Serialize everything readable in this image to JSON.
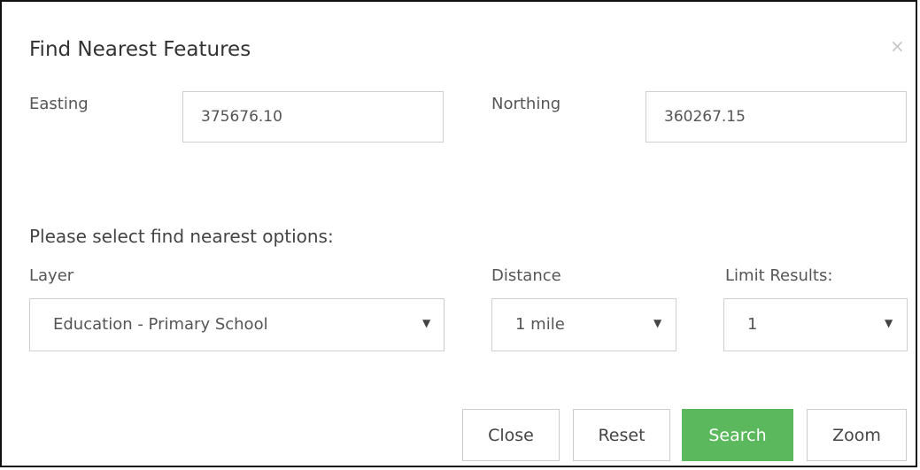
{
  "dialog": {
    "title": "Find Nearest Features",
    "close_glyph": "×"
  },
  "coordinates": {
    "easting_label": "Easting",
    "easting_value": "375676.10",
    "northing_label": "Northing",
    "northing_value": "360267.15"
  },
  "options": {
    "section_title": "Please select find nearest options:",
    "layer_label": "Layer",
    "layer_selected": "Education - Primary School",
    "distance_label": "Distance",
    "distance_selected": "1 mile",
    "limit_label": "Limit Results:",
    "limit_selected": "1",
    "caret_glyph": "▼"
  },
  "buttons": {
    "close": "Close",
    "reset": "Reset",
    "search": "Search",
    "zoom": "Zoom"
  },
  "colors": {
    "primary": "#5cb85c",
    "border": "#cfcfcf",
    "text": "#555555"
  }
}
